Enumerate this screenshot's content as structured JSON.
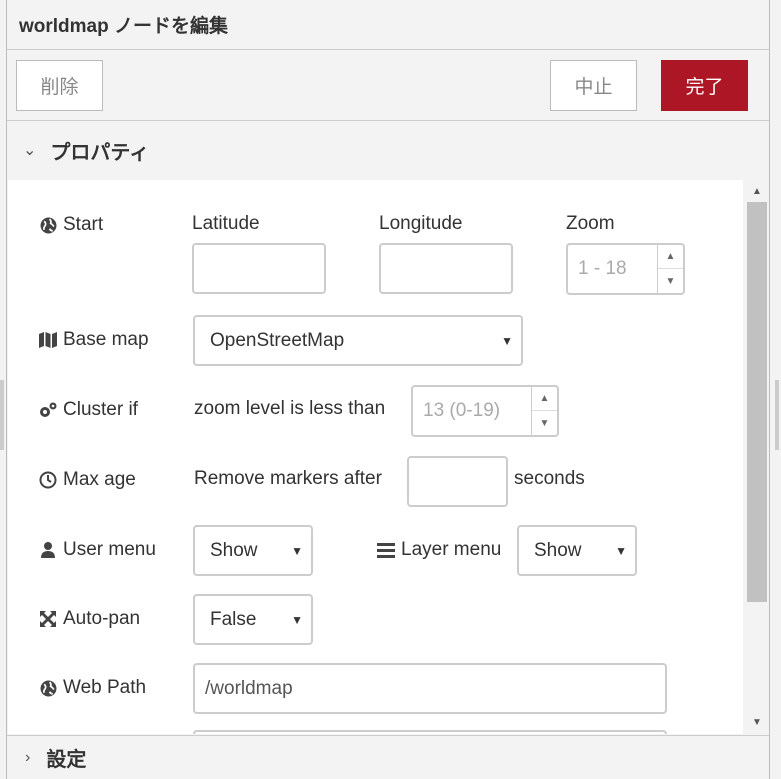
{
  "header": {
    "title": "worldmap ノードを編集"
  },
  "toolbar": {
    "delete_label": "削除",
    "cancel_label": "中止",
    "done_label": "完了"
  },
  "sections": {
    "properties": "プロパティ",
    "settings": "設定"
  },
  "colors": {
    "primary": "#ad1625"
  },
  "form": {
    "start": {
      "label": "Start",
      "latitude_label": "Latitude",
      "longitude_label": "Longitude",
      "zoom_label": "Zoom",
      "latitude_value": "",
      "longitude_value": "",
      "zoom_placeholder": "1 - 18"
    },
    "base_map": {
      "label": "Base map",
      "value": "OpenStreetMap"
    },
    "cluster": {
      "label": "Cluster if",
      "text": "zoom level is less than",
      "placeholder": "13 (0-19)"
    },
    "max_age": {
      "label": "Max age",
      "prefix": "Remove markers after",
      "suffix": "seconds",
      "value": ""
    },
    "user_menu": {
      "label": "User menu",
      "value": "Show"
    },
    "layer_menu": {
      "label": "Layer menu",
      "value": "Show"
    },
    "auto_pan": {
      "label": "Auto-pan",
      "value": "False"
    },
    "web_path": {
      "label": "Web Path",
      "value": "/worldmap"
    }
  },
  "icons": {
    "start": "globe-icon",
    "base_map": "map-icon",
    "cluster": "cogs-icon",
    "max_age": "clock-icon",
    "user_menu": "user-icon",
    "layer_menu": "bars-icon",
    "auto_pan": "arrows-alt-icon",
    "web_path": "globe-icon"
  }
}
